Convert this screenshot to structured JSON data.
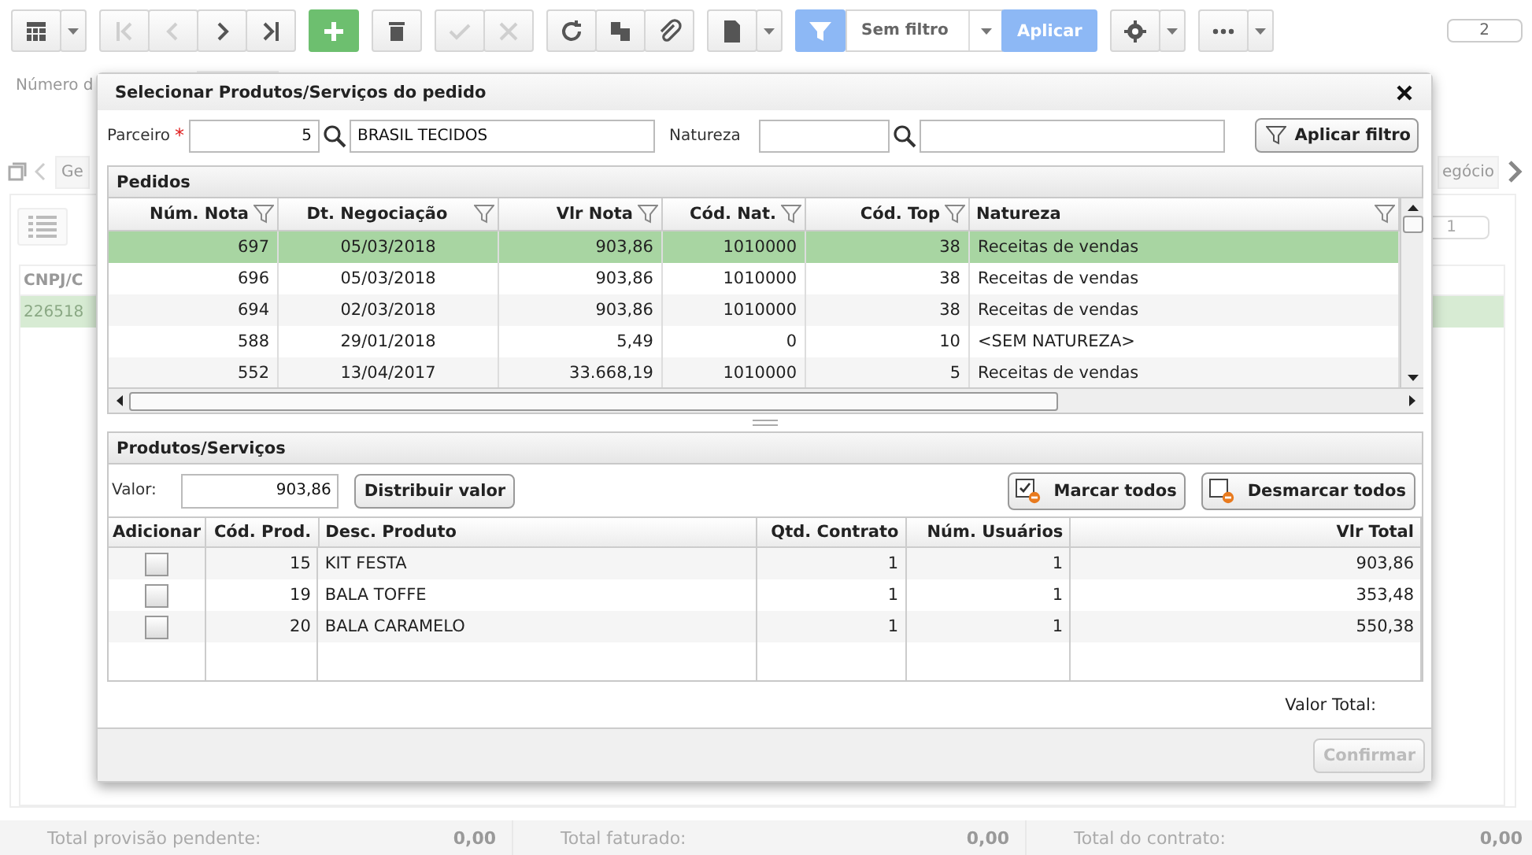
{
  "toolbar": {
    "groups": [
      {
        "kind": "buttons",
        "buttons": [
          {
            "disabled": false
          }
        ],
        "dropdown": true
      },
      {
        "kind": "buttons",
        "buttons": [
          {
            "disabled": true
          },
          {
            "disabled": true
          },
          {
            "disabled": false
          },
          {
            "disabled": false
          }
        ],
        "dropdown": false
      },
      {
        "kind": "buttons",
        "buttons": [
          {
            "disabled": false
          }
        ],
        "dropdown": false
      },
      {
        "kind": "buttons",
        "buttons": [
          {
            "disabled": false
          }
        ],
        "dropdown": false
      },
      {
        "kind": "buttons",
        "buttons": [
          {
            "disabled": true
          },
          {
            "disabled": true
          }
        ],
        "dropdown": false
      },
      {
        "kind": "buttons",
        "buttons": [
          {
            "disabled": false
          },
          {
            "disabled": false
          },
          {
            "disabled": false
          }
        ],
        "dropdown": false
      },
      {
        "kind": "buttons",
        "buttons": [
          {
            "disabled": false
          }
        ],
        "dropdown": true
      },
      {
        "kind": "filter",
        "value": "Sem filtro",
        "apply_label": "Aplicar"
      },
      {
        "kind": "buttons",
        "buttons": [
          {
            "disabled": false
          }
        ],
        "dropdown": true
      },
      {
        "kind": "buttons",
        "buttons": [
          {
            "disabled": false
          }
        ],
        "dropdown": true
      }
    ],
    "badge": "2"
  },
  "background_form": {
    "field_label": "Número d",
    "tabs": [
      {
        "label": "Ge"
      },
      {
        "label": "egócio"
      }
    ],
    "badge": "1",
    "grid": {
      "columns": [
        "CNPJ/C"
      ],
      "rows": [
        {
          "cells": [
            "226518"
          ],
          "selected": true
        }
      ]
    }
  },
  "footer": [
    {
      "label": "Total provisão pendente:",
      "value": "0,00"
    },
    {
      "label": "Total faturado:",
      "value": "0,00"
    },
    {
      "label": "Total do contrato:",
      "value": "0,00"
    }
  ],
  "dialog": {
    "title": "Selecionar Produtos/Serviços do pedido",
    "filters": {
      "partner_label": "Parceiro",
      "partner_required_mark": "*",
      "partner_code": "5",
      "partner_name": "BRASIL TECIDOS",
      "nature_label": "Natureza",
      "apply_label": "Aplicar filtro"
    },
    "orders": {
      "title": "Pedidos",
      "columns": [
        {
          "label": "Núm. Nota",
          "filter": true
        },
        {
          "label": "Dt. Negociação",
          "filter": true
        },
        {
          "label": "Vlr Nota",
          "filter": true
        },
        {
          "label": "Cód. Nat.",
          "filter": true
        },
        {
          "label": "Cód. Top",
          "filter": true
        },
        {
          "label": "Natureza",
          "filter": true
        }
      ],
      "rows": [
        {
          "cells": [
            "697",
            "05/03/2018",
            "903,86",
            "1010000",
            "38",
            "Receitas de vendas"
          ],
          "selected": true
        },
        {
          "cells": [
            "696",
            "05/03/2018",
            "903,86",
            "1010000",
            "38",
            "Receitas de vendas"
          ],
          "selected": false
        },
        {
          "cells": [
            "694",
            "02/03/2018",
            "903,86",
            "1010000",
            "38",
            "Receitas de vendas"
          ],
          "selected": false
        },
        {
          "cells": [
            "588",
            "29/01/2018",
            "5,49",
            "0",
            "10",
            "<SEM NATUREZA>"
          ],
          "selected": false
        },
        {
          "cells": [
            "552",
            "13/04/2017",
            "33.668,19",
            "1010000",
            "5",
            "Receitas de vendas"
          ],
          "selected": false
        }
      ]
    },
    "products": {
      "title": "Produtos/Serviços",
      "value_label": "Valor:",
      "value": "903,86",
      "distribute_label": "Distribuir valor",
      "mark_all_label": "Marcar todos",
      "unmark_all_label": "Desmarcar todos",
      "columns": [
        "Adicionar",
        "Cód. Prod.",
        "Desc. Produto",
        "Qtd. Contrato",
        "Núm. Usuários",
        "Vlr Total"
      ],
      "rows": [
        {
          "checked": false,
          "cells": [
            "",
            "15",
            "KIT FESTA",
            "1",
            "1",
            "903,86"
          ]
        },
        {
          "checked": false,
          "cells": [
            "",
            "19",
            "BALA TOFFE",
            "1",
            "1",
            "353,48"
          ]
        },
        {
          "checked": false,
          "cells": [
            "",
            "20",
            "BALA CARAMELO",
            "1",
            "1",
            "550,38"
          ]
        }
      ],
      "total_label": "Valor Total:"
    },
    "confirm": {
      "label": "Confirmar",
      "disabled": true
    }
  }
}
